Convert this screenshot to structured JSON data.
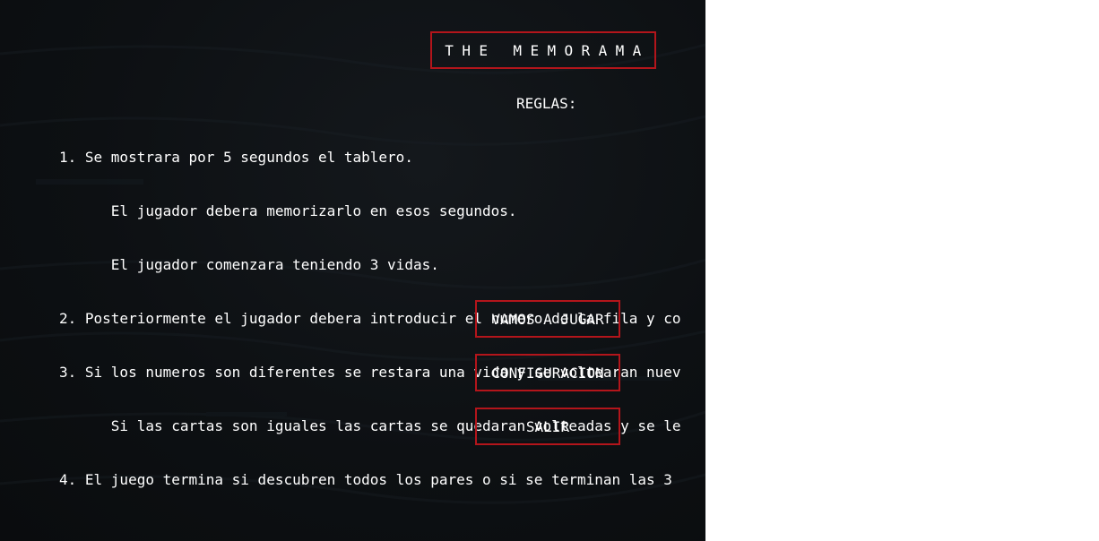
{
  "title": "THE MEMORAMA",
  "rules_heading": "REGLAS:",
  "rules": [
    "1. Se mostrara por 5 segundos el tablero.",
    "      El jugador debera memorizarlo en esos segundos.",
    "      El jugador comenzara teniendo 3 vidas.",
    "2. Posteriormente el jugador debera introducir el numero de la fila y co",
    "3. Si los numeros son diferentes se restara una vida y se voltearan nuev",
    "      Si las cartas son iguales las cartas se quedaran volteadas y se le",
    "4. El juego termina si descubren todos los pares o si se terminan las 3"
  ],
  "menu": {
    "play_label": "VAMOS A JUGAR",
    "config_label": "CONFIGURACION",
    "exit_label": "SALIR"
  },
  "colors": {
    "accent_border": "#b3151b",
    "background": "#0d1013",
    "text": "#ffffff"
  }
}
